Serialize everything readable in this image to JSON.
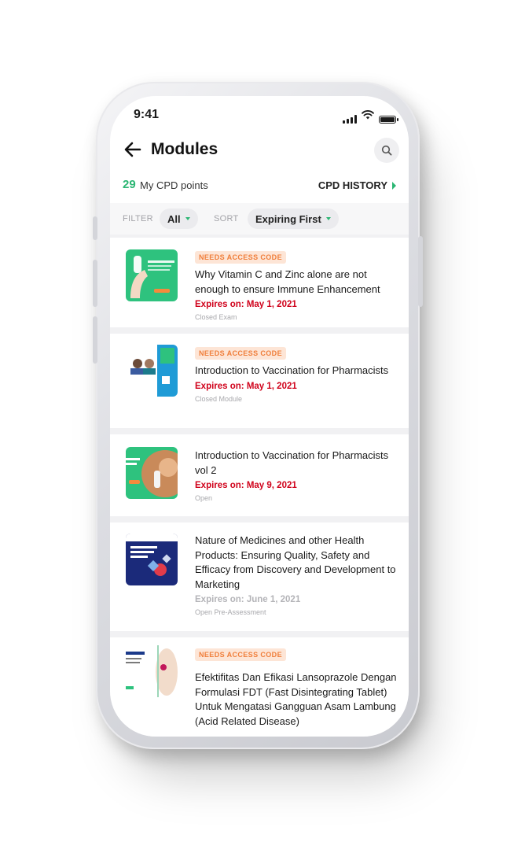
{
  "status_bar": {
    "time": "9:41"
  },
  "header": {
    "title": "Modules",
    "points_value": "29",
    "points_label": "My CPD points",
    "history_label": "CPD HISTORY"
  },
  "filter": {
    "filter_label": "FILTER",
    "filter_value": "All",
    "sort_label": "SORT",
    "sort_value": "Expiring First"
  },
  "modules": [
    {
      "badge": "NEEDS ACCESS CODE",
      "title": "Why Vitamin C and Zinc alone are not enough to ensure Immune Enhancement",
      "expires": "Expires on: May 1, 2021",
      "status": "Closed Exam"
    },
    {
      "badge": "NEEDS ACCESS CODE",
      "title": "Introduction to Vaccination for Pharmacists",
      "expires": "Expires on: May 1, 2021",
      "status": "Closed Module"
    },
    {
      "title": "Introduction to Vaccination for Pharmacists vol 2",
      "expires": "Expires on: May 9, 2021",
      "status": "Open"
    },
    {
      "title": "Nature of Medicines and other Health Products: Ensuring Quality, Safety and Efficacy from Discovery and Development to Marketing",
      "expires": "Expires on: June 1, 2021",
      "status": "Open Pre-Assessment"
    },
    {
      "badge": "NEEDS ACCESS CODE",
      "title": "Efektifitas Dan Efikasi Lansoprazole Dengan Formulasi FDT (Fast Disintegrating Tablet) Untuk Mengatasi Gangguan Asam Lambung (Acid Related Disease)"
    }
  ],
  "colors": {
    "accent_green": "#2bb673",
    "expires_red": "#d0021b",
    "badge_orange": "#f07e3a",
    "badge_bg": "#fde5d6"
  },
  "icons": [
    "signal-icon",
    "wifi-icon",
    "battery-icon",
    "back-arrow-icon",
    "search-icon",
    "chevron-right-icon",
    "caret-down-icon"
  ]
}
